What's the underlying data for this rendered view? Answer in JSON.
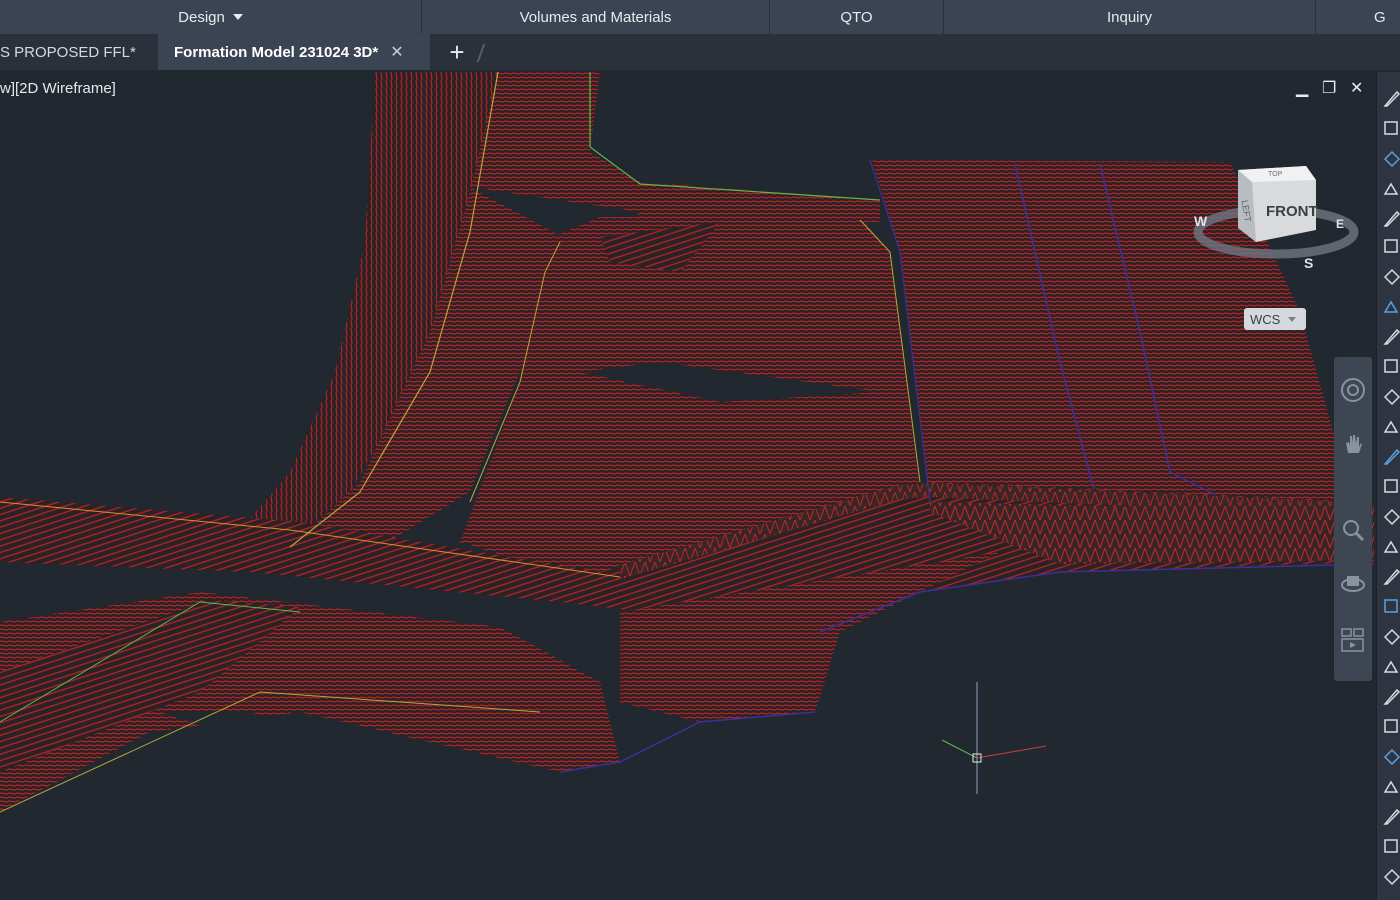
{
  "ribbon": {
    "panels": [
      {
        "label": "Design",
        "has_dropdown": true
      },
      {
        "label": "Volumes and Materials"
      },
      {
        "label": "QTO"
      },
      {
        "label": "Inquiry"
      },
      {
        "label": "G"
      }
    ]
  },
  "tabs": {
    "items": [
      {
        "label": "S PROPOSED FFL*",
        "active": false
      },
      {
        "label": "Formation Model 231024 3D*",
        "active": true
      }
    ],
    "close_glyph": "✕",
    "new_tab_glyph": "+"
  },
  "viewport": {
    "label": "w][2D Wireframe]",
    "controls": {
      "minimize": "▁",
      "restore": "❐",
      "close": "✕"
    },
    "viewcube": {
      "face": "FRONT",
      "left_face": "LEFT",
      "top_face": "TOP",
      "compass": [
        "W",
        "S",
        "E"
      ]
    },
    "ucs": {
      "label": "WCS"
    }
  },
  "colors": {
    "background": "#212830",
    "ribbon": "#3b4453",
    "wire_red": "#b52424",
    "wire_yellow": "#b8a83a",
    "wire_green": "#5fb84a",
    "boundary_blue": "#3b2f9a"
  },
  "icons": [
    "steering-wheel-icon",
    "pan-hand-icon",
    "zoom-icon",
    "orbit-icon",
    "showmotion-icon"
  ]
}
